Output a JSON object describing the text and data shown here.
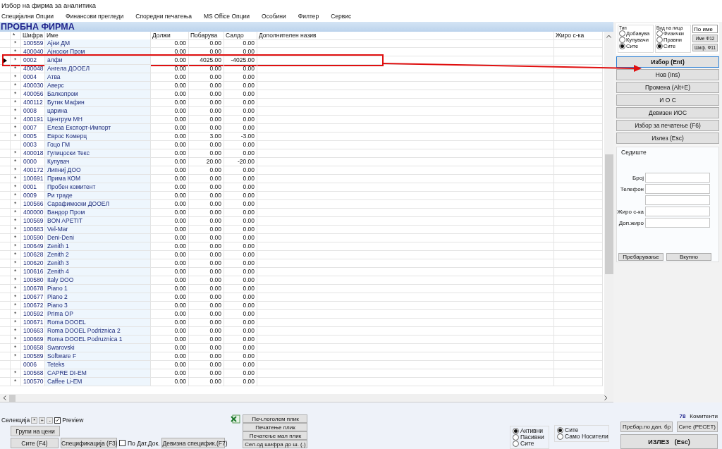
{
  "window": {
    "title": "Избор на фирма за аналитика"
  },
  "menu": [
    "Специјални Опции",
    "Финансови прегледи",
    "Споредни печатења",
    "MS Office Опции",
    "Особини",
    "Филтер",
    "Сервис"
  ],
  "company": "ПРОБНА ФИРМА",
  "table": {
    "header_marker": "*",
    "columns": [
      "Шифра",
      "Име",
      "Должи",
      "Побарува",
      "Салдо",
      "Дополнителен назив",
      "Жиро с-ка"
    ],
    "rows": [
      {
        "marker": "*",
        "code": "100559",
        "name": "Ајни ДМ",
        "debit": "0.00",
        "credit": "0.00",
        "balance": "0.00",
        "current": false,
        "highlighted": false
      },
      {
        "marker": "*",
        "code": "400040",
        "name": "Ајноски Пром",
        "debit": "0.00",
        "credit": "0.00",
        "balance": "0.00",
        "current": false,
        "highlighted": false
      },
      {
        "marker": "*",
        "code": "0002",
        "name": "алфи",
        "debit": "0.00",
        "credit": "4025.00",
        "balance": "-4025.00",
        "current": true,
        "highlighted": true
      },
      {
        "marker": "*",
        "code": "400048",
        "name": "Ангела ДООЕЛ",
        "debit": "0.00",
        "credit": "0.00",
        "balance": "0.00",
        "current": false,
        "highlighted": false
      },
      {
        "marker": "*",
        "code": "0004",
        "name": "Атва",
        "debit": "0.00",
        "credit": "0.00",
        "balance": "0.00",
        "current": false,
        "highlighted": false
      },
      {
        "marker": "*",
        "code": "400030",
        "name": "Аверс",
        "debit": "0.00",
        "credit": "0.00",
        "balance": "0.00",
        "current": false,
        "highlighted": false
      },
      {
        "marker": "*",
        "code": "400056",
        "name": "Балкопром",
        "debit": "0.00",
        "credit": "0.00",
        "balance": "0.00",
        "current": false,
        "highlighted": false
      },
      {
        "marker": "*",
        "code": "400112",
        "name": "Бутик Мафин",
        "debit": "0.00",
        "credit": "0.00",
        "balance": "0.00",
        "current": false,
        "highlighted": false
      },
      {
        "marker": "*",
        "code": "0008",
        "name": "царина",
        "debit": "0.00",
        "credit": "0.00",
        "balance": "0.00",
        "current": false,
        "highlighted": false
      },
      {
        "marker": "*",
        "code": "400191",
        "name": "Центрум МН",
        "debit": "0.00",
        "credit": "0.00",
        "balance": "0.00",
        "current": false,
        "highlighted": false
      },
      {
        "marker": "*",
        "code": "0007",
        "name": "Елеза Експорт-Импорт",
        "debit": "0.00",
        "credit": "0.00",
        "balance": "0.00",
        "current": false,
        "highlighted": false
      },
      {
        "marker": "*",
        "code": "0005",
        "name": "Еврос Комерц",
        "debit": "0.00",
        "credit": "3.00",
        "balance": "-3.00",
        "current": false,
        "highlighted": false
      },
      {
        "code": "0003",
        "name": "Гоцо ГМ",
        "debit": "0.00",
        "credit": "0.00",
        "balance": "0.00",
        "current": false,
        "highlighted": false
      },
      {
        "marker": "*",
        "code": "400018",
        "name": "Гулицоски Текс",
        "debit": "0.00",
        "credit": "0.00",
        "balance": "0.00",
        "current": false,
        "highlighted": false
      },
      {
        "marker": "*",
        "code": "0000",
        "name": "Купувач",
        "debit": "0.00",
        "credit": "20.00",
        "balance": "-20.00",
        "current": false,
        "highlighted": false
      },
      {
        "marker": "*",
        "code": "400172",
        "name": "Липниј ДОО",
        "debit": "0.00",
        "credit": "0.00",
        "balance": "0.00",
        "current": false,
        "highlighted": false
      },
      {
        "marker": "*",
        "code": "100691",
        "name": "Прима КОМ",
        "debit": "0.00",
        "credit": "0.00",
        "balance": "0.00",
        "current": false,
        "highlighted": false
      },
      {
        "marker": "*",
        "code": "0001",
        "name": "Пробен комитент",
        "debit": "0.00",
        "credit": "0.00",
        "balance": "0.00",
        "current": false,
        "highlighted": false
      },
      {
        "marker": "*",
        "code": "0009",
        "name": "Ри траде",
        "debit": "0.00",
        "credit": "0.00",
        "balance": "0.00",
        "current": false,
        "highlighted": false
      },
      {
        "marker": "*",
        "code": "100566",
        "name": "Сарафимоски ДООЕЛ",
        "debit": "0.00",
        "credit": "0.00",
        "balance": "0.00",
        "current": false,
        "highlighted": false
      },
      {
        "marker": "*",
        "code": "400000",
        "name": "Вандор Пром",
        "debit": "0.00",
        "credit": "0.00",
        "balance": "0.00",
        "current": false,
        "highlighted": false
      },
      {
        "marker": "*",
        "code": "100569",
        "name": "BON APETIT",
        "debit": "0.00",
        "credit": "0.00",
        "balance": "0.00",
        "current": false,
        "highlighted": false
      },
      {
        "marker": "*",
        "code": "100683",
        "name": "Vel-Mar",
        "debit": "0.00",
        "credit": "0.00",
        "balance": "0.00",
        "current": false,
        "highlighted": false
      },
      {
        "marker": "*",
        "code": "100590",
        "name": "Deni-Deni",
        "debit": "0.00",
        "credit": "0.00",
        "balance": "0.00",
        "current": false,
        "highlighted": false
      },
      {
        "marker": "*",
        "code": "100649",
        "name": "Zenith 1",
        "debit": "0.00",
        "credit": "0.00",
        "balance": "0.00",
        "current": false,
        "highlighted": false
      },
      {
        "marker": "*",
        "code": "100628",
        "name": "Zenith 2",
        "debit": "0.00",
        "credit": "0.00",
        "balance": "0.00",
        "current": false,
        "highlighted": false
      },
      {
        "marker": "*",
        "code": "100620",
        "name": "Zenith 3",
        "debit": "0.00",
        "credit": "0.00",
        "balance": "0.00",
        "current": false,
        "highlighted": false
      },
      {
        "marker": "*",
        "code": "100616",
        "name": "Zenith 4",
        "debit": "0.00",
        "credit": "0.00",
        "balance": "0.00",
        "current": false,
        "highlighted": false
      },
      {
        "marker": "*",
        "code": "100580",
        "name": "Italy DOO",
        "debit": "0.00",
        "credit": "0.00",
        "balance": "0.00",
        "current": false,
        "highlighted": false
      },
      {
        "marker": "*",
        "code": "100678",
        "name": "Piano 1",
        "debit": "0.00",
        "credit": "0.00",
        "balance": "0.00",
        "current": false,
        "highlighted": false
      },
      {
        "marker": "*",
        "code": "100677",
        "name": "Piano 2",
        "debit": "0.00",
        "credit": "0.00",
        "balance": "0.00",
        "current": false,
        "highlighted": false
      },
      {
        "marker": "*",
        "code": "100672",
        "name": "Piano 3",
        "debit": "0.00",
        "credit": "0.00",
        "balance": "0.00",
        "current": false,
        "highlighted": false
      },
      {
        "marker": "*",
        "code": "100592",
        "name": "Prima OP",
        "debit": "0.00",
        "credit": "0.00",
        "balance": "0.00",
        "current": false,
        "highlighted": false
      },
      {
        "marker": "*",
        "code": "100671",
        "name": "Roma DOOEL",
        "debit": "0.00",
        "credit": "0.00",
        "balance": "0.00",
        "current": false,
        "highlighted": false
      },
      {
        "marker": "*",
        "code": "100663",
        "name": "Roma DOOEL Podriznica 2",
        "debit": "0.00",
        "credit": "0.00",
        "balance": "0.00",
        "current": false,
        "highlighted": false
      },
      {
        "marker": "*",
        "code": "100669",
        "name": "Roma DOOEL Podruznica 1",
        "debit": "0.00",
        "credit": "0.00",
        "balance": "0.00",
        "current": false,
        "highlighted": false
      },
      {
        "marker": "*",
        "code": "100658",
        "name": "Swarovski",
        "debit": "0.00",
        "credit": "0.00",
        "balance": "0.00",
        "current": false,
        "highlighted": false
      },
      {
        "marker": "*",
        "code": "100589",
        "name": "Software F",
        "debit": "0.00",
        "credit": "0.00",
        "balance": "0.00",
        "current": false,
        "highlighted": false
      },
      {
        "code": "0006",
        "name": "Teteks",
        "debit": "0.00",
        "credit": "0.00",
        "balance": "0.00",
        "current": false,
        "highlighted": false
      },
      {
        "marker": "*",
        "code": "100568",
        "name": "CAPRE DI-EM",
        "debit": "0.00",
        "credit": "0.00",
        "balance": "0.00",
        "current": false,
        "highlighted": false
      },
      {
        "marker": "*",
        "code": "100570",
        "name": "Caffee Li-EM",
        "debit": "0.00",
        "credit": "0.00",
        "balance": "0.00",
        "current": false,
        "highlighted": false
      }
    ]
  },
  "right_panel": {
    "type_filter": {
      "label": "Тип",
      "options": [
        {
          "label": "Добавува",
          "selected": false
        },
        {
          "label": "Купувачи",
          "selected": false
        },
        {
          "label": "Сите",
          "selected": true
        }
      ]
    },
    "person_filter": {
      "label": "Вид на лица",
      "options": [
        {
          "label": "Физички",
          "selected": false
        },
        {
          "label": "Правни",
          "selected": false
        },
        {
          "label": "Сите",
          "selected": true
        }
      ]
    },
    "sort_field": {
      "value": "По име"
    },
    "sort_buttons": [
      "Име Ф12",
      "Шиф. Ф11"
    ],
    "actions": [
      {
        "label": "Избор (Ent)",
        "default": true
      },
      {
        "label": "Нов (Ins)",
        "default": false
      },
      {
        "label": "Промена (Alt+E)",
        "default": false
      },
      {
        "label": "И О С",
        "default": false
      },
      {
        "label": "Девизен ИОС",
        "default": false
      },
      {
        "label": "Избор за печатење (F6)",
        "default": false
      },
      {
        "label": "Излез (Esc)",
        "default": false
      }
    ],
    "details": {
      "title": "Седиште",
      "fields": [
        {
          "kind": "labeled",
          "label": "Број"
        },
        {
          "kind": "labeled",
          "label": "Телефон"
        },
        {
          "kind": "blank"
        },
        {
          "kind": "labeled",
          "label": "Жиро с-ка"
        },
        {
          "kind": "labeled",
          "label": "Доп.жиро"
        }
      ],
      "buttons": [
        "Пребарување",
        "Вкупно"
      ]
    }
  },
  "bottom": {
    "selection": {
      "label": "Селекција",
      "buttons": [
        "*",
        "+",
        "-"
      ],
      "preview": {
        "label": "Preview",
        "checked": true
      }
    },
    "price_groups_button": "Групи на цени",
    "all_button": "Сите (F4)",
    "spec_button": "Спецификација (F3)",
    "by_date": {
      "label": "По Дат.Док.",
      "checked": false
    },
    "fx_spec_button": "Девизна специфик.(F7)",
    "print_buttons": [
      "Печ.логолем плик",
      "Печатење плик",
      "Печатење мал плик",
      "Сел.од шифра до ш. (.)"
    ],
    "status_filter": [
      {
        "label": "Активни",
        "selected": true
      },
      {
        "label": "Пасивни",
        "selected": false
      },
      {
        "label": "Сите",
        "selected": false
      }
    ],
    "carrier_filter": [
      {
        "label": "Сите",
        "selected": true
      },
      {
        "label": "Само Носители",
        "selected": false
      }
    ],
    "count": {
      "value": "78",
      "label": "Комитенти"
    },
    "search_button": "Пребар.по дан. бр",
    "reset_button": "Сите (РЕСЕТ)",
    "exit_button": "ИЗЛЕЗ   (Esc)"
  }
}
